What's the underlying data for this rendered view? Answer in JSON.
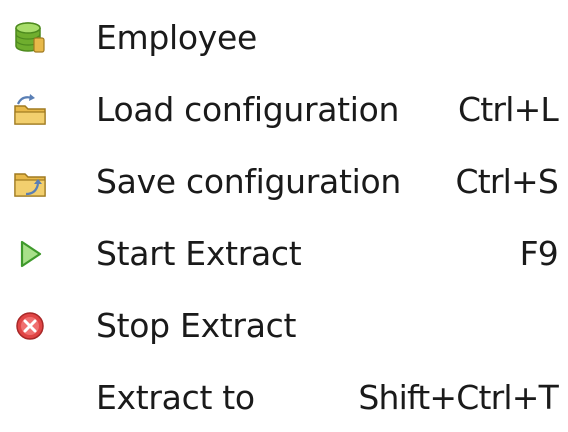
{
  "menu": {
    "items": [
      {
        "label": "Employee",
        "shortcut": "",
        "icon": "database-icon"
      },
      {
        "label": "Load configuration",
        "shortcut": "Ctrl+L",
        "icon": "load-folder-icon"
      },
      {
        "label": "Save configuration",
        "shortcut": "Ctrl+S",
        "icon": "save-folder-icon"
      },
      {
        "label": "Start Extract",
        "shortcut": "F9",
        "icon": "play-icon"
      },
      {
        "label": "Stop Extract",
        "shortcut": "",
        "icon": "stop-icon"
      },
      {
        "label": "Extract to",
        "shortcut": "Shift+Ctrl+T",
        "icon": ""
      }
    ]
  },
  "colors": {
    "database": "#6fae2e",
    "folder": "#e8b94a",
    "play": "#4caf3a",
    "stop": "#e04545",
    "text": "#1a1a1a"
  }
}
